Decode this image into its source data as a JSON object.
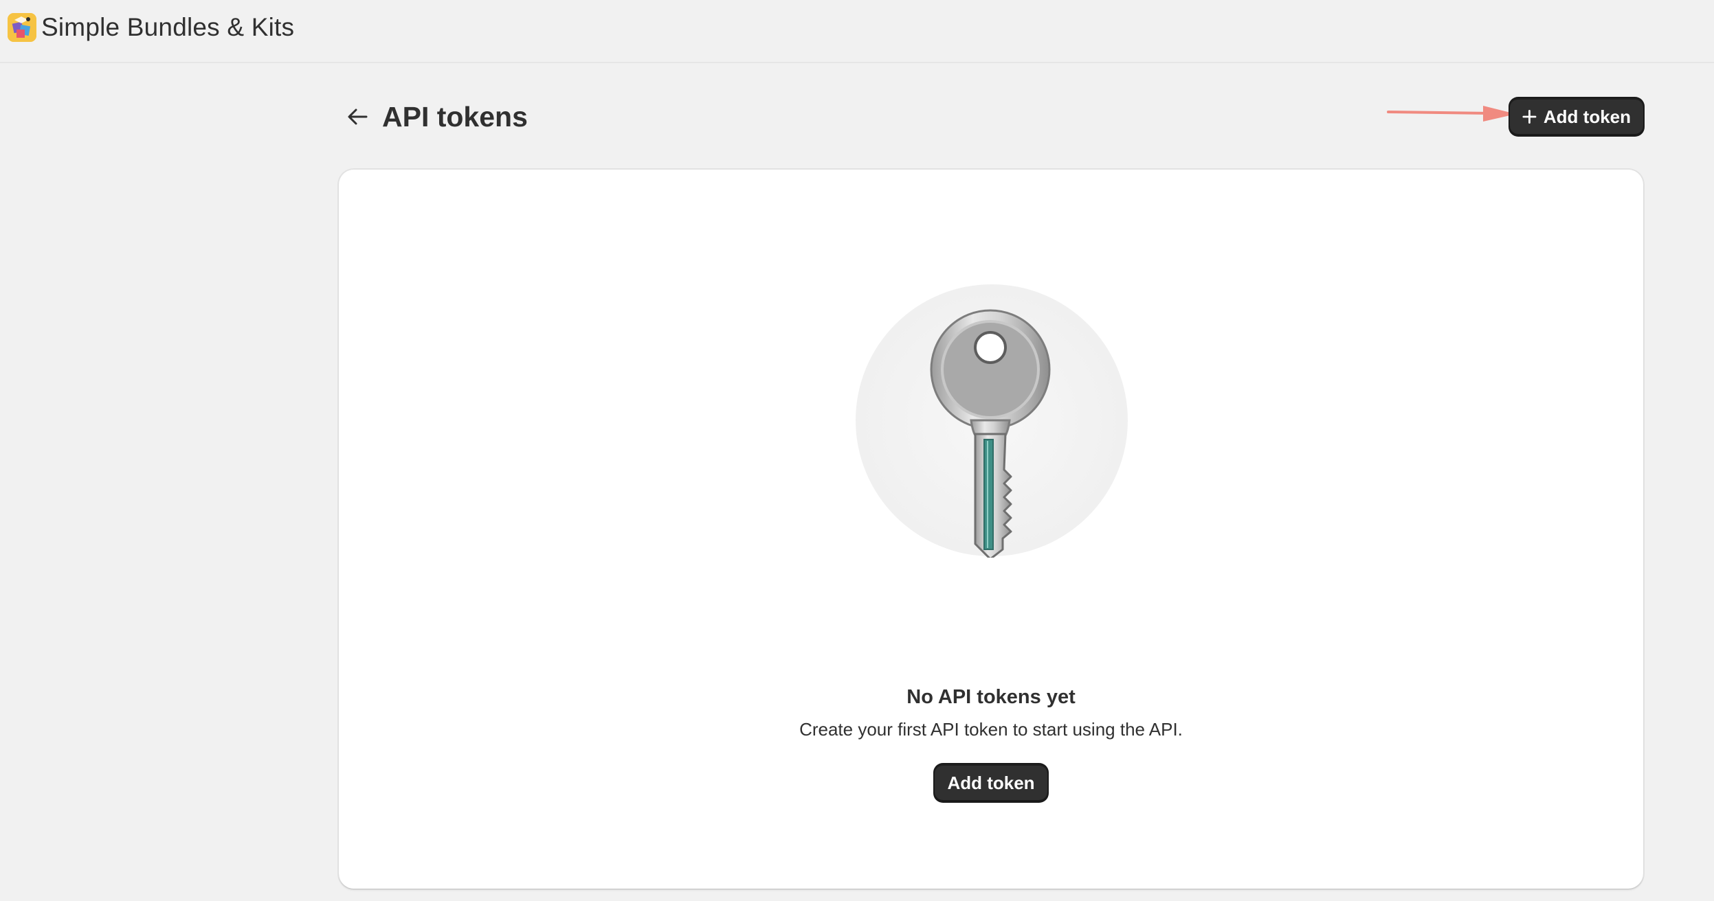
{
  "app": {
    "title": "Simple Bundles & Kits",
    "logo_icon": "bundle-box-logo-icon"
  },
  "header": {
    "back_icon": "arrow-left-icon",
    "page_title": "API tokens",
    "add_button_icon": "plus-icon",
    "add_button_label": "Add token"
  },
  "empty_state": {
    "illustration": "key-illustration",
    "heading": "No API tokens yet",
    "description": "Create your first API token to start using the API.",
    "button_label": "Add token"
  },
  "colors": {
    "page_background": "#f1f1f1",
    "card_background": "#ffffff",
    "primary_button": "#303030",
    "annotation_arrow": "#f08a80",
    "key_accent": "#3f8f86"
  }
}
